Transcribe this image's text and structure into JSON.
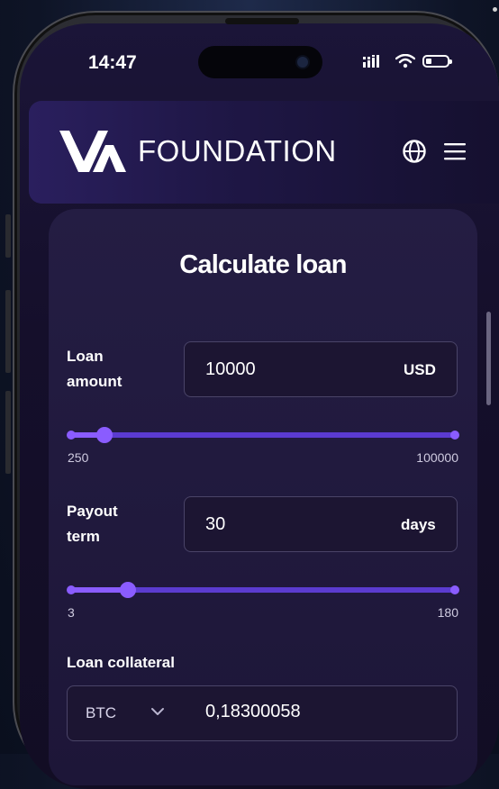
{
  "status_bar": {
    "time": "14:47"
  },
  "header": {
    "logo_text": "VA",
    "brand": "FOUNDATION",
    "icons": [
      "globe-icon",
      "menu-icon"
    ]
  },
  "calculator": {
    "title": "Calculate loan",
    "loan_amount": {
      "label_line1": "Loan",
      "label_line2": "amount",
      "value": "10000",
      "unit": "USD",
      "min_label": "250",
      "max_label": "100000",
      "slider_position": 0.09
    },
    "payout_term": {
      "label_line1": "Payout",
      "label_line2": "term",
      "value": "30",
      "unit": "days",
      "min_label": "3",
      "max_label": "180",
      "slider_position": 0.15
    },
    "collateral": {
      "label": "Loan collateral",
      "currency": "BTC",
      "amount": "0,18300058"
    }
  },
  "colors": {
    "accent": "#8a5cff",
    "track": "#5b3bd0",
    "background": "#0e1426",
    "card": "#221b40"
  }
}
